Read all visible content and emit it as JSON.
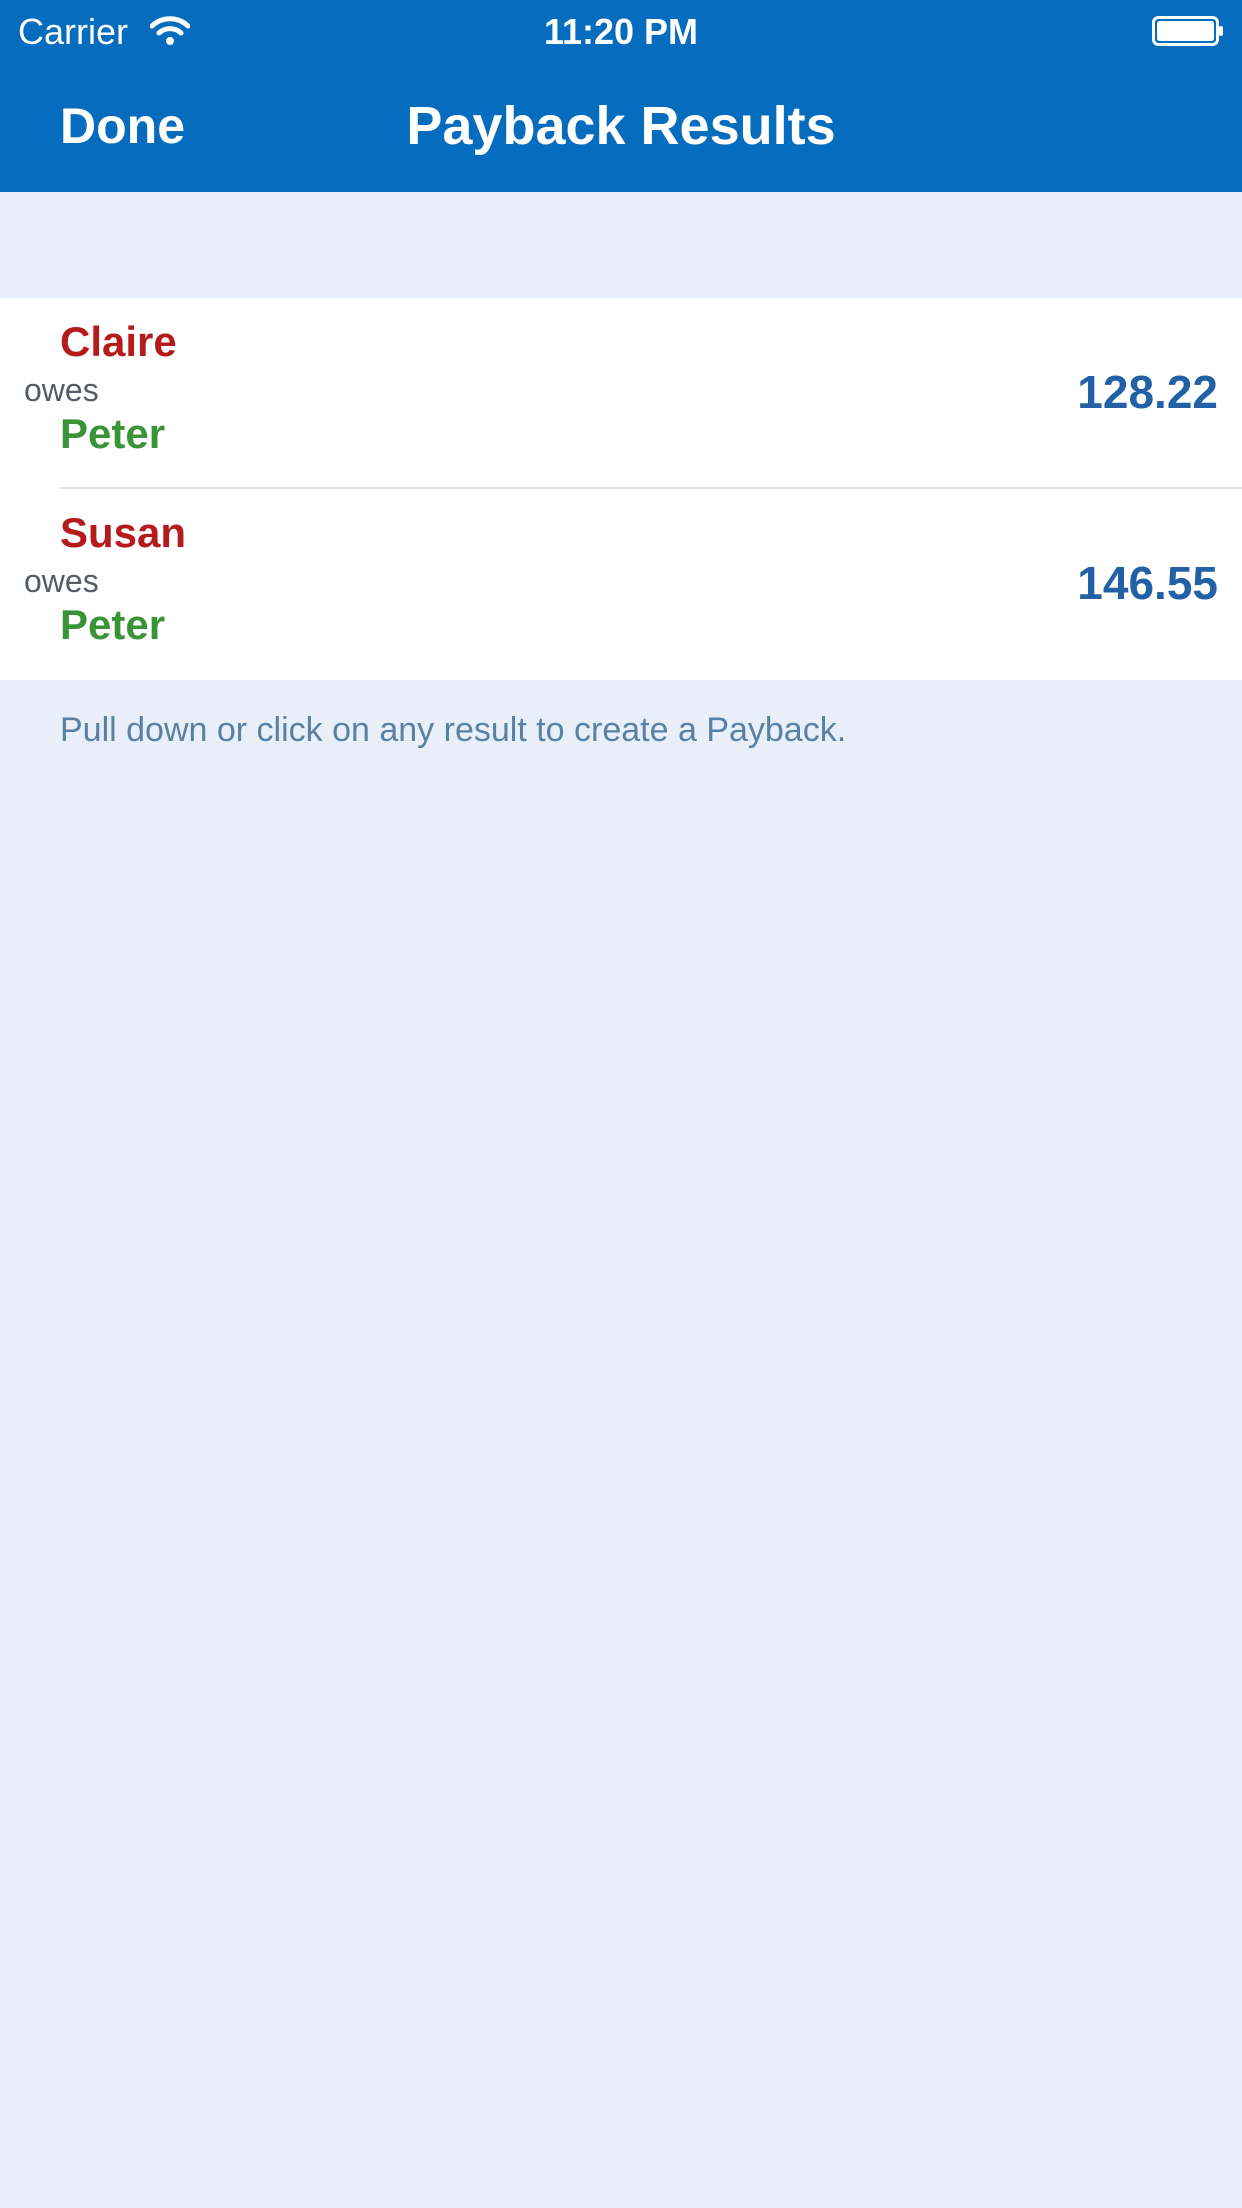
{
  "status_bar": {
    "carrier": "Carrier",
    "time": "11:20 PM",
    "icons": [
      "wifi-icon",
      "battery-icon"
    ]
  },
  "nav": {
    "done_label": "Done",
    "title": "Payback Results"
  },
  "results": [
    {
      "debtor": "Claire",
      "verb": "owes",
      "creditor": "Peter",
      "amount": "128.22"
    },
    {
      "debtor": "Susan",
      "verb": "owes",
      "creditor": "Peter",
      "amount": "146.55"
    }
  ],
  "hint": "Pull down or click on any result to create a Payback.",
  "colors": {
    "nav_background": "#066cbd",
    "page_background": "#e8eff9",
    "debtor": "#b51b1b",
    "creditor": "#3a9437",
    "amount": "#2261a6",
    "hint": "#5a80a3"
  }
}
